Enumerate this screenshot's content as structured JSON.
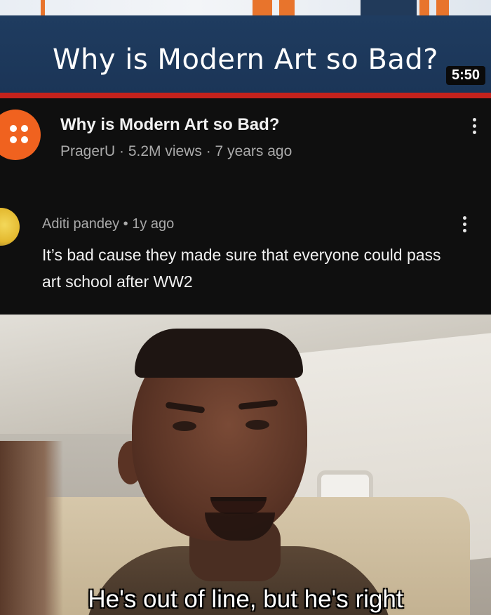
{
  "video": {
    "thumbnail_title": "Why is Modern Art so Bad?",
    "duration": "5:50",
    "title": "Why is Modern Art so Bad?",
    "meta": "PragerU · 5.2M views · 7 years ago",
    "channel_color": "#f0621f"
  },
  "comment": {
    "author": "Aditi pandey • 1y ago",
    "text": "It’s bad cause they made sure that everyone could pass art school after WW2"
  },
  "meme": {
    "caption": "He's out of line, but he's right"
  },
  "icons": {
    "video_menu": "more-vert-icon",
    "comment_menu": "more-vert-icon"
  }
}
